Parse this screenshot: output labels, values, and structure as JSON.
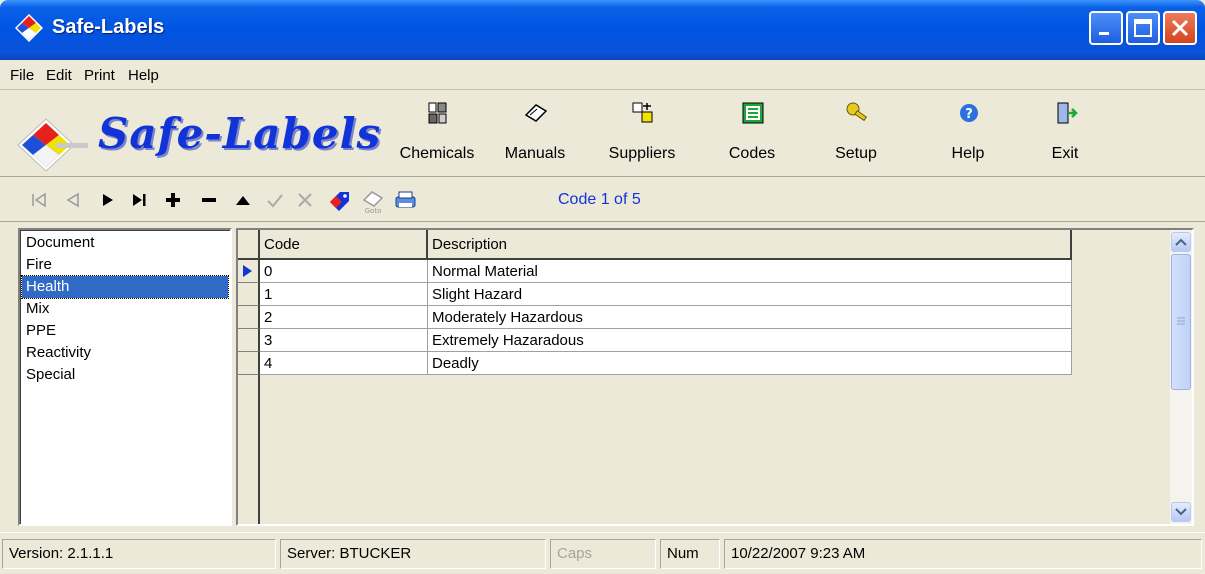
{
  "window": {
    "title": "Safe-Labels"
  },
  "menu": [
    "File",
    "Edit",
    "Print",
    "Help"
  ],
  "brand": {
    "text": "Safe-Labels"
  },
  "toolbar": [
    {
      "label": "Chemicals",
      "icon": "chemicals-icon"
    },
    {
      "label": "Manuals",
      "icon": "manuals-icon"
    },
    {
      "label": "Suppliers",
      "icon": "suppliers-icon"
    },
    {
      "label": "Codes",
      "icon": "codes-icon"
    },
    {
      "label": "Setup",
      "icon": "setup-key-icon"
    },
    {
      "label": "Help",
      "icon": "help-icon"
    },
    {
      "label": "Exit",
      "icon": "exit-icon"
    }
  ],
  "navigator": {
    "buttons": [
      "first-record",
      "prior-record",
      "next-record",
      "last-record",
      "insert-record",
      "delete-record",
      "edit-record",
      "post-record",
      "cancel-record",
      "label-tag",
      "goto",
      "print"
    ],
    "status": "Code 1 of 5"
  },
  "categories": {
    "items": [
      "Document",
      "Fire",
      "Health",
      "Mix",
      "PPE",
      "Reactivity",
      "Special"
    ],
    "selected": "Health"
  },
  "grid": {
    "columns": [
      "Code",
      "Description"
    ],
    "rows": [
      {
        "code": "0",
        "description": "Normal Material",
        "current": true
      },
      {
        "code": "1",
        "description": "Slight Hazard",
        "current": false
      },
      {
        "code": "2",
        "description": "Moderately Hazardous",
        "current": false
      },
      {
        "code": "3",
        "description": "Extremely Hazaradous",
        "current": false
      },
      {
        "code": "4",
        "description": "Deadly",
        "current": false
      }
    ]
  },
  "status": {
    "version": "Version: 2.1.1.1",
    "server": "Server: BTUCKER",
    "caps": "Caps",
    "num": "Num",
    "datetime": "10/22/2007 9:23 AM"
  },
  "colors": {
    "titlebar": "#0054e3",
    "brand": "#1134d8",
    "selection": "#316ac5",
    "face": "#ece9d8"
  }
}
